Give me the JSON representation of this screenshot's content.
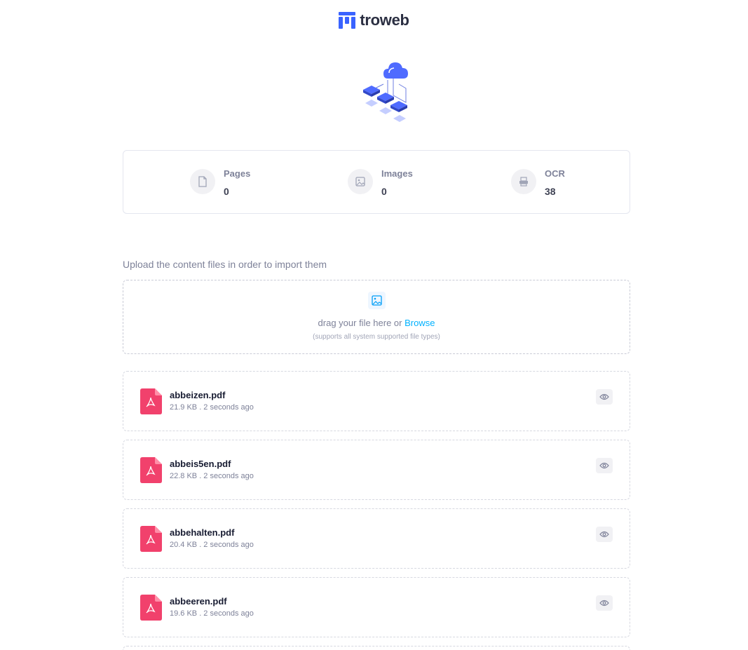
{
  "brand": {
    "name": "troweb"
  },
  "stats": [
    {
      "label": "Pages",
      "value": "0",
      "icon": "file-icon"
    },
    {
      "label": "Images",
      "value": "0",
      "icon": "image-icon"
    },
    {
      "label": "OCR",
      "value": "38",
      "icon": "ocr-scanner-icon"
    }
  ],
  "upload": {
    "title": "Upload the content files in order to import them",
    "drop_text": "drag your file here or",
    "browse_label": "Browse",
    "supports_text": "(supports all system supported file types)"
  },
  "files": [
    {
      "name": "abbeizen.pdf",
      "meta": "21.9 KB . 2 seconds ago"
    },
    {
      "name": "abbeis5en.pdf",
      "meta": "22.8 KB . 2 seconds ago"
    },
    {
      "name": "abbehalten.pdf",
      "meta": "20.4 KB . 2 seconds ago"
    },
    {
      "name": "abbeeren.pdf",
      "meta": "19.6 KB . 2 seconds ago"
    }
  ],
  "colors": {
    "accent": "#00b2ff",
    "pdf_red": "#f1416c",
    "brand_blue": "#3a63ff"
  }
}
